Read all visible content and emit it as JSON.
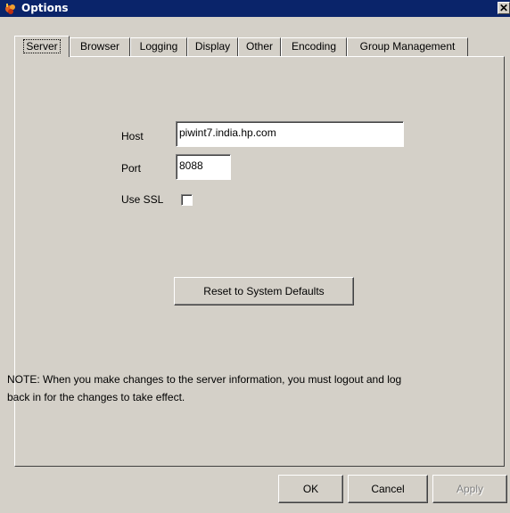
{
  "window": {
    "title": "Options",
    "close_glyph": "✕"
  },
  "tabs": [
    {
      "label": "Server",
      "active": true
    },
    {
      "label": "Browser",
      "active": false
    },
    {
      "label": "Logging",
      "active": false
    },
    {
      "label": "Display",
      "active": false
    },
    {
      "label": "Other",
      "active": false
    },
    {
      "label": "Encoding",
      "active": false
    },
    {
      "label": "Group Management",
      "active": false
    }
  ],
  "server": {
    "host_label": "Host",
    "host_value": "piwint7.india.hp.com",
    "port_label": "Port",
    "port_value": "8088",
    "ssl_label": "Use SSL",
    "ssl_checked": false,
    "reset_label": "Reset to System Defaults",
    "note_line1": "NOTE: When you make changes to the server information, you must logout and log",
    "note_line2": "back in for the changes to take effect."
  },
  "buttons": {
    "ok": "OK",
    "cancel": "Cancel",
    "apply": "Apply"
  }
}
